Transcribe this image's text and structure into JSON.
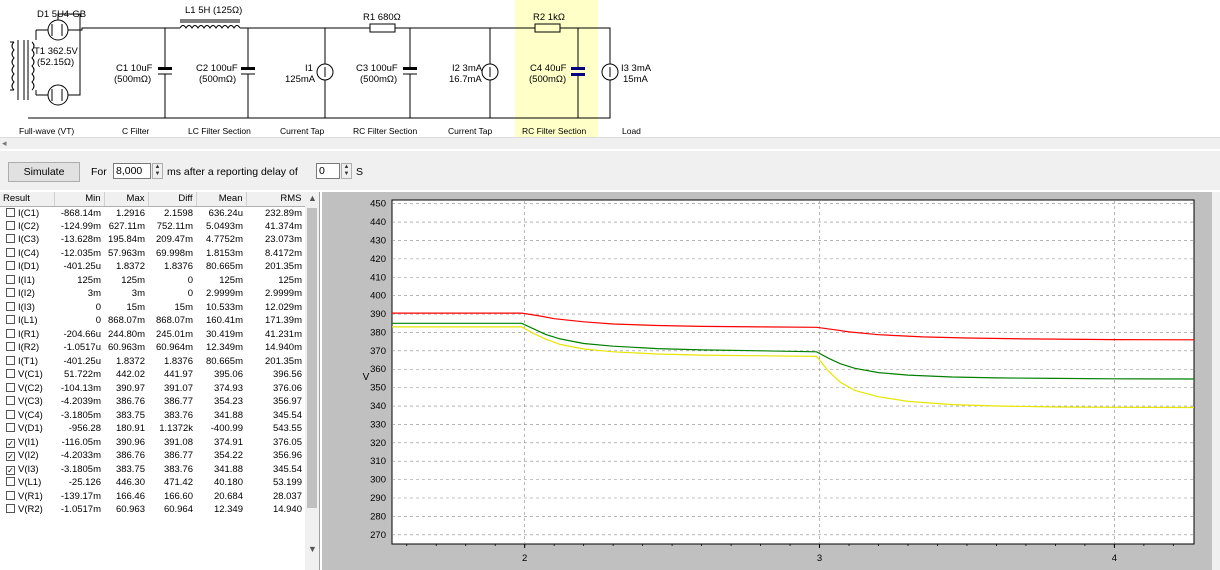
{
  "schematic": {
    "labels": {
      "d1": "D1 5U4-GB",
      "t1_line1": "T1 362.5V",
      "t1_line2": "(52.15Ω)",
      "l1": "L1 5H (125Ω)",
      "r1": "R1 680Ω",
      "r2": "R2 1kΩ",
      "c1_1": "C1 10uF",
      "c1_2": "(500mΩ)",
      "c2_1": "C2 100uF",
      "c2_2": "(500mΩ)",
      "i1_1": "I1",
      "i1_2": "125mA",
      "c3_1": "C3 100uF",
      "c3_2": "(500mΩ)",
      "i2_1": "I2 3mA",
      "i2_2": "16.7mA",
      "c4_1": "C4 40uF",
      "c4_2": "(500mΩ)",
      "i3_1": "I3 3mA",
      "i3_2": "15mA"
    },
    "sections": [
      "Full-wave (VT)",
      "C Filter",
      "LC Filter Section",
      "Current Tap",
      "RC Filter Section",
      "Current Tap",
      "RC Filter Section",
      "Load"
    ],
    "highlight_color": "#ffffc8"
  },
  "toolbar": {
    "simulate_label": "Simulate",
    "for_label": "For",
    "duration_value": "8,000",
    "ms_label": "ms  after a reporting delay of",
    "delay_value": "0",
    "s_label": "S"
  },
  "results": {
    "headers": [
      "Result",
      "Min",
      "Max",
      "Diff",
      "Mean",
      "RMS"
    ],
    "rows": [
      {
        "name": "I(C1)",
        "checked": false,
        "values": [
          "-868.14m",
          "1.2916",
          "2.1598",
          "636.24u",
          "232.89m"
        ]
      },
      {
        "name": "I(C2)",
        "checked": false,
        "values": [
          "-124.99m",
          "627.11m",
          "752.11m",
          "5.0493m",
          "41.374m"
        ]
      },
      {
        "name": "I(C3)",
        "checked": false,
        "values": [
          "-13.628m",
          "195.84m",
          "209.47m",
          "4.7752m",
          "23.073m"
        ]
      },
      {
        "name": "I(C4)",
        "checked": false,
        "values": [
          "-12.035m",
          "57.963m",
          "69.998m",
          "1.8153m",
          "8.4172m"
        ]
      },
      {
        "name": "I(D1)",
        "checked": false,
        "values": [
          "-401.25u",
          "1.8372",
          "1.8376",
          "80.665m",
          "201.35m"
        ]
      },
      {
        "name": "I(I1)",
        "checked": false,
        "values": [
          "125m",
          "125m",
          "0",
          "125m",
          "125m"
        ]
      },
      {
        "name": "I(I2)",
        "checked": false,
        "values": [
          "3m",
          "3m",
          "0",
          "2.9999m",
          "2.9999m"
        ]
      },
      {
        "name": "I(I3)",
        "checked": false,
        "values": [
          "0",
          "15m",
          "15m",
          "10.533m",
          "12.029m"
        ]
      },
      {
        "name": "I(L1)",
        "checked": false,
        "values": [
          "0",
          "868.07m",
          "868.07m",
          "160.41m",
          "171.39m"
        ]
      },
      {
        "name": "I(R1)",
        "checked": false,
        "values": [
          "-204.66u",
          "244.80m",
          "245.01m",
          "30.419m",
          "41.231m"
        ]
      },
      {
        "name": "I(R2)",
        "checked": false,
        "values": [
          "-1.0517u",
          "60.963m",
          "60.964m",
          "12.349m",
          "14.940m"
        ]
      },
      {
        "name": "I(T1)",
        "checked": false,
        "values": [
          "-401.25u",
          "1.8372",
          "1.8376",
          "80.665m",
          "201.35m"
        ]
      },
      {
        "name": "V(C1)",
        "checked": false,
        "values": [
          "51.722m",
          "442.02",
          "441.97",
          "395.06",
          "396.56"
        ]
      },
      {
        "name": "V(C2)",
        "checked": false,
        "values": [
          "-104.13m",
          "390.97",
          "391.07",
          "374.93",
          "376.06"
        ]
      },
      {
        "name": "V(C3)",
        "checked": false,
        "values": [
          "-4.2039m",
          "386.76",
          "386.77",
          "354.23",
          "356.97"
        ]
      },
      {
        "name": "V(C4)",
        "checked": false,
        "values": [
          "-3.1805m",
          "383.75",
          "383.76",
          "341.88",
          "345.54"
        ]
      },
      {
        "name": "V(D1)",
        "checked": false,
        "values": [
          "-956.28",
          "180.91",
          "1.1372k",
          "-400.99",
          "543.55"
        ]
      },
      {
        "name": "V(I1)",
        "checked": true,
        "values": [
          "-116.05m",
          "390.96",
          "391.08",
          "374.91",
          "376.05"
        ]
      },
      {
        "name": "V(I2)",
        "checked": true,
        "values": [
          "-4.2033m",
          "386.76",
          "386.77",
          "354.22",
          "356.96"
        ]
      },
      {
        "name": "V(I3)",
        "checked": true,
        "values": [
          "-3.1805m",
          "383.75",
          "383.76",
          "341.88",
          "345.54"
        ]
      },
      {
        "name": "V(L1)",
        "checked": false,
        "values": [
          "-25.126",
          "446.30",
          "471.42",
          "40.180",
          "53.199"
        ]
      },
      {
        "name": "V(R1)",
        "checked": false,
        "values": [
          "-139.17m",
          "166.46",
          "166.60",
          "20.684",
          "28.037"
        ]
      },
      {
        "name": "V(R2)",
        "checked": false,
        "values": [
          "-1.0517m",
          "60.963",
          "60.964",
          "12.349",
          "14.940"
        ]
      }
    ]
  },
  "chart_data": {
    "type": "line",
    "ylabel": "V",
    "xlabel": "",
    "ylim": [
      265,
      452
    ],
    "xlim": [
      1.55,
      4.27
    ],
    "yticks": [
      270,
      280,
      290,
      300,
      310,
      320,
      330,
      340,
      350,
      360,
      370,
      380,
      390,
      400,
      410,
      420,
      430,
      440,
      450
    ],
    "xticks": [
      2,
      3,
      4
    ],
    "grid": true,
    "background": "#c0c0c0",
    "plot_bg": "#ffffff",
    "series": [
      {
        "color": "#ff0000",
        "x": [
          1.55,
          1.99,
          2.05,
          2.1,
          2.2,
          2.3,
          2.45,
          2.6,
          2.8,
          2.99,
          3.05,
          3.1,
          3.2,
          3.35,
          3.5,
          3.7,
          4.0,
          4.27
        ],
        "y": [
          390.5,
          390.5,
          389,
          387.5,
          385.8,
          384.6,
          383.8,
          383.3,
          383,
          382.8,
          381.5,
          380.3,
          378.8,
          377.6,
          377,
          376.5,
          376.1,
          376
        ]
      },
      {
        "color": "#008000",
        "x": [
          1.55,
          1.99,
          2.03,
          2.07,
          2.12,
          2.2,
          2.3,
          2.45,
          2.6,
          2.8,
          2.99,
          3.03,
          3.07,
          3.12,
          3.2,
          3.3,
          3.45,
          3.6,
          3.8,
          4.0,
          4.27
        ],
        "y": [
          385,
          385,
          382,
          379,
          376.5,
          374,
          372.5,
          371.2,
          370.5,
          370,
          369.5,
          366,
          363,
          360.5,
          358.2,
          356.8,
          355.8,
          355.3,
          355,
          354.8,
          354.7
        ]
      },
      {
        "color": "#e6e600",
        "x": [
          1.55,
          1.99,
          2.03,
          2.07,
          2.12,
          2.2,
          2.3,
          2.45,
          2.6,
          2.8,
          2.99,
          3.03,
          3.07,
          3.12,
          3.2,
          3.3,
          3.45,
          3.6,
          3.8,
          4.0,
          4.27
        ],
        "y": [
          383,
          383,
          379.5,
          376.5,
          373.5,
          371,
          369.5,
          368.3,
          367.7,
          367.3,
          367,
          359,
          353,
          348.5,
          345,
          342.5,
          340.8,
          340,
          339.5,
          339.3,
          339.2
        ]
      }
    ]
  }
}
